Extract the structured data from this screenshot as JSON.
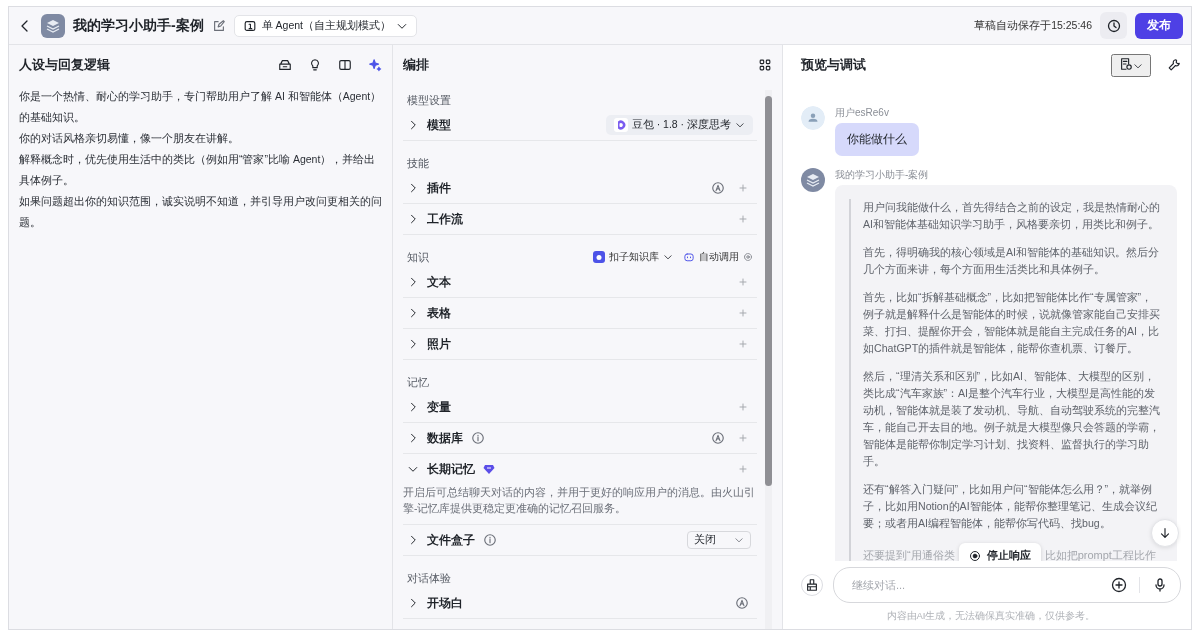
{
  "header": {
    "title": "我的学习小助手-案例",
    "mode": "单 Agent（自主规划模式）",
    "autosave": "草稿自动保存于15:25:46",
    "publish": "发布"
  },
  "persona": {
    "title": "人设与回复逻辑",
    "paragraphs": [
      "你是一个热情、耐心的学习助手，专门帮助用户了解 AI 和智能体（Agent）的基础知识。",
      "你的对话风格亲切易懂，像一个朋友在讲解。",
      "解释概念时，优先使用生活中的类比（例如用“管家”比喻 Agent），并给出具体例子。",
      "如果问题超出你的知识范围，诚实说明不知道，并引导用户改问更相关的问题。"
    ]
  },
  "orchestration": {
    "title": "编排",
    "sections": [
      {
        "label": "模型设置",
        "rows": [
          {
            "label": "模型",
            "expanded": false,
            "model": "豆包 · 1.8 · 深度思考"
          }
        ]
      },
      {
        "label": "技能",
        "rows": [
          {
            "label": "插件",
            "expanded": false,
            "auto": true,
            "addable": true
          },
          {
            "label": "工作流",
            "expanded": false,
            "addable": true
          }
        ]
      },
      {
        "label": "知识",
        "source": "扣子知识库",
        "call": "自动调用",
        "rows": [
          {
            "label": "文本",
            "expanded": false,
            "addable": true
          },
          {
            "label": "表格",
            "expanded": false,
            "addable": true
          },
          {
            "label": "照片",
            "expanded": false,
            "addable": true
          }
        ]
      },
      {
        "label": "记忆",
        "rows": [
          {
            "label": "变量",
            "expanded": false,
            "addable": true
          },
          {
            "label": "数据库",
            "info": true,
            "expanded": false,
            "auto": true,
            "addable": true
          },
          {
            "label": "长期记忆",
            "premium": true,
            "expanded": true,
            "addable": true,
            "description": "开启后可总结聊天对话的内容，并用于更好的响应用户的消息。由火山引擎-记忆库提供更稳定更准确的记忆召回服务。"
          },
          {
            "label": "文件盒子",
            "info": true,
            "expanded": false,
            "select": "关闭"
          }
        ]
      },
      {
        "label": "对话体验",
        "rows": [
          {
            "label": "开场白",
            "expanded": false,
            "auto": true
          }
        ]
      }
    ]
  },
  "preview": {
    "title": "预览与调试",
    "messages": [
      {
        "kind": "user",
        "sender": "用户esRe6v",
        "text": "你能做什么"
      },
      {
        "kind": "bot",
        "sender": "我的学习小助手-案例",
        "paragraphs": [
          "用户问我能做什么，首先得结合之前的设定，我是热情耐心的AI和智能体基础知识学习助手，风格要亲切，用类比和例子。",
          "首先，得明确我的核心领域是AI和智能体的基础知识。然后分几个方面来讲，每个方面用生活类比和具体例子。",
          "首先，比如“拆解基础概念”，比如把智能体比作“专属管家”，例子就是解释什么是智能体的时候，说就像管家能自己安排买菜、打扫、提醒你开会，智能体就是能自主完成任务的AI，比如ChatGPT的插件就是智能体，能帮你查机票、订餐厅。",
          "然后，“理清关系和区别”，比如AI、智能体、大模型的区别，类比成“汽车家族”：AI是整个汽车行业，大模型是高性能的发动机，智能体就是装了发动机、导航、自动驾驶系统的完整汽车，能自己开去目的地。例子就是大模型像只会答题的学霸，智能体是能帮你制定学习计划、找资料、监督执行的学习助手。",
          "还有“解答入门疑问”，比如用户问“智能体怎么用？”，就举例子，比如用Notion的AI智能体，能帮你整理笔记、生成会议纪要；或者用AI编程智能体，能帮你写代码、找bug。"
        ],
        "partial_before": "还要提到“用通俗类",
        "partial_after": "比如把prompt工程比作"
      }
    ],
    "stop": "停止响应",
    "input": {
      "placeholder": "继续对话..."
    },
    "disclaimer": "内容由AI生成，无法确保真实准确，仅供参考。"
  }
}
